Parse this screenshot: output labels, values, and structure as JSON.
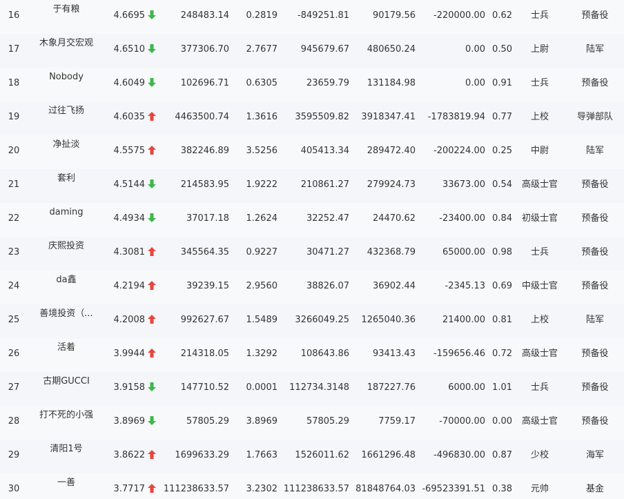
{
  "colors": {
    "up": "#e8453c",
    "down": "#3cb84a",
    "text": "#333333"
  },
  "rows": [
    {
      "rank": "16",
      "name": "于有粮",
      "score": "4.6695",
      "trend": "down",
      "v1": "248483.14",
      "v2": "0.2819",
      "v3": "-849251.81",
      "v4": "90179.56",
      "v5": "-220000.00",
      "v6": "0.62",
      "title": "士兵",
      "group": "预备役"
    },
    {
      "rank": "17",
      "name": "木象月交宏观",
      "score": "4.6510",
      "trend": "down",
      "v1": "377306.70",
      "v2": "2.7677",
      "v3": "945679.67",
      "v4": "480650.24",
      "v5": "0.00",
      "v6": "0.50",
      "title": "上尉",
      "group": "陆军"
    },
    {
      "rank": "18",
      "name": "Nobody",
      "score": "4.6049",
      "trend": "down",
      "v1": "102696.71",
      "v2": "0.6305",
      "v3": "23659.79",
      "v4": "131184.98",
      "v5": "0.00",
      "v6": "0.91",
      "title": "士兵",
      "group": "预备役"
    },
    {
      "rank": "19",
      "name": "过往飞扬",
      "score": "4.6035",
      "trend": "up",
      "v1": "4463500.74",
      "v2": "1.3616",
      "v3": "3595509.82",
      "v4": "3918347.41",
      "v5": "-1783819.94",
      "v6": "0.77",
      "title": "上校",
      "group": "导弹部队"
    },
    {
      "rank": "20",
      "name": "净扯淡",
      "score": "4.5575",
      "trend": "up",
      "v1": "382246.89",
      "v2": "3.5256",
      "v3": "405413.34",
      "v4": "289472.40",
      "v5": "-200224.00",
      "v6": "0.25",
      "title": "中尉",
      "group": "陆军"
    },
    {
      "rank": "21",
      "name": "套利",
      "score": "4.5144",
      "trend": "down",
      "v1": "214583.95",
      "v2": "1.9222",
      "v3": "210861.27",
      "v4": "279924.73",
      "v5": "33673.00",
      "v6": "0.54",
      "title": "高级士官",
      "group": "预备役"
    },
    {
      "rank": "22",
      "name": "daming",
      "score": "4.4934",
      "trend": "down",
      "v1": "37017.18",
      "v2": "1.2624",
      "v3": "32252.47",
      "v4": "24470.62",
      "v5": "-23400.00",
      "v6": "0.84",
      "title": "初级士官",
      "group": "预备役"
    },
    {
      "rank": "23",
      "name": "庆熙投资",
      "score": "4.3081",
      "trend": "up",
      "v1": "345564.35",
      "v2": "0.9227",
      "v3": "30471.27",
      "v4": "432368.79",
      "v5": "65000.00",
      "v6": "0.98",
      "title": "士兵",
      "group": "预备役"
    },
    {
      "rank": "24",
      "name": "da鑫",
      "score": "4.2194",
      "trend": "up",
      "v1": "39239.15",
      "v2": "2.9560",
      "v3": "38826.07",
      "v4": "36902.44",
      "v5": "-2345.13",
      "v6": "0.69",
      "title": "中级士官",
      "group": "预备役"
    },
    {
      "rank": "25",
      "name": "善境投资（...",
      "score": "4.2008",
      "trend": "up",
      "v1": "992627.67",
      "v2": "1.5489",
      "v3": "3266049.25",
      "v4": "1265040.36",
      "v5": "21400.00",
      "v6": "0.81",
      "title": "上校",
      "group": "陆军"
    },
    {
      "rank": "26",
      "name": "活着",
      "score": "3.9944",
      "trend": "up",
      "v1": "214318.05",
      "v2": "1.3292",
      "v3": "108643.86",
      "v4": "93413.43",
      "v5": "-159656.46",
      "v6": "0.72",
      "title": "高级士官",
      "group": "预备役"
    },
    {
      "rank": "27",
      "name": "古期GUCCI",
      "score": "3.9158",
      "trend": "down",
      "v1": "147710.52",
      "v2": "0.0001",
      "v3": "112734.3148",
      "v4": "187227.76",
      "v5": "6000.00",
      "v6": "1.01",
      "title": "士兵",
      "group": "预备役"
    },
    {
      "rank": "28",
      "name": "打不死的小强",
      "score": "3.8969",
      "trend": "down",
      "v1": "57805.29",
      "v2": "3.8969",
      "v3": "57805.29",
      "v4": "7759.17",
      "v5": "-70000.00",
      "v6": "0.00",
      "title": "高级士官",
      "group": "预备役"
    },
    {
      "rank": "29",
      "name": "清阳1号",
      "score": "3.8622",
      "trend": "up",
      "v1": "1699633.29",
      "v2": "1.7663",
      "v3": "1526011.62",
      "v4": "1661296.48",
      "v5": "-496830.00",
      "v6": "0.87",
      "title": "少校",
      "group": "海军"
    },
    {
      "rank": "30",
      "name": "一善",
      "score": "3.7717",
      "trend": "up",
      "v1": "111238633.57",
      "v2": "3.2302",
      "v3": "111238633.57",
      "v4": "81848764.03",
      "v5": "-69523391.51",
      "v6": "0.38",
      "title": "元帅",
      "group": "基金"
    }
  ]
}
